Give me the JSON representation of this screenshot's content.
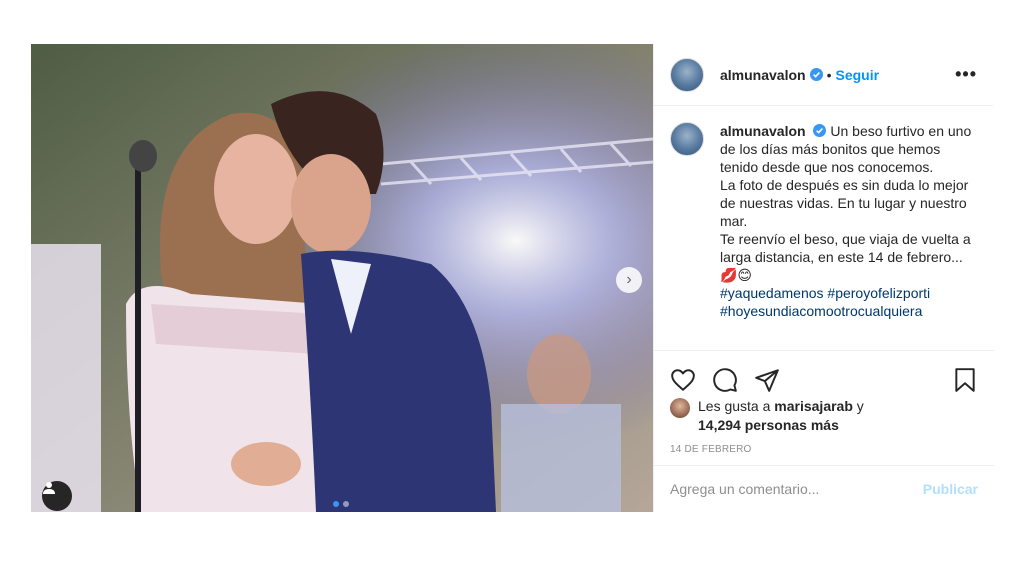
{
  "post": {
    "username": "almunavalon",
    "follow_label": "Seguir",
    "separator": "•",
    "more_label": "•••",
    "caption_user": "almunavalon",
    "caption_body": "Un beso furtivo en uno de los días más bonitos que hemos tenido desde que nos conocemos.",
    "caption_line2": "La foto de después es sin duda lo mejor de nuestras vidas. En tu lugar y nuestro mar.",
    "caption_line3": "Te reenvío el beso, que viaja de vuelta a larga distancia, en este 14 de febrero...💋😊",
    "hashtags": [
      "#yaquedamenos #peroyofelizporti",
      "#hoyesundiacomootrocualquiera"
    ],
    "likes_prefix": "Les gusta a",
    "likes_user": "marisajarab",
    "likes_and": "y",
    "likes_count": "14,294 personas más",
    "date": "14 DE FEBRERO",
    "comment_placeholder": "Agrega un comentario...",
    "publish_label": "Publicar",
    "next_arrow": "›"
  },
  "icons": {
    "like": "heart-icon",
    "comment": "comment-icon",
    "share": "paper-plane-icon",
    "save": "bookmark-icon",
    "verified": "verified-badge-icon",
    "tag": "user-tag-icon"
  },
  "colors": {
    "accent": "#0095f6",
    "verified": "#3897f0",
    "hashtag": "#00376b",
    "muted": "#8e8e8e",
    "publish_disabled": "#b2dffc"
  },
  "carousel": {
    "pages": 2,
    "active": 1
  }
}
